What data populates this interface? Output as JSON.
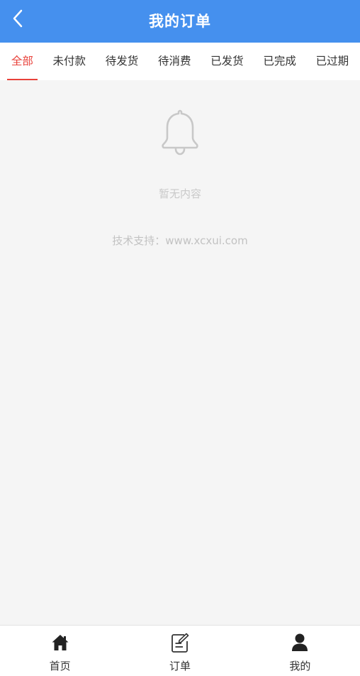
{
  "header": {
    "title": "我的订单",
    "back_icon": "chevron-left-icon",
    "bg_color": "#4590ee"
  },
  "tabs": [
    {
      "label": "全部",
      "active": true
    },
    {
      "label": "未付款",
      "active": false
    },
    {
      "label": "待发货",
      "active": false
    },
    {
      "label": "待消费",
      "active": false
    },
    {
      "label": "已发货",
      "active": false
    },
    {
      "label": "已完成",
      "active": false
    },
    {
      "label": "已过期",
      "active": false
    }
  ],
  "empty_state": {
    "icon": "bell-icon",
    "text": "暂无内容"
  },
  "support_text": "技术支持：www.xcxui.com",
  "bottom_nav": [
    {
      "label": "首页",
      "icon": "home-icon"
    },
    {
      "label": "订单",
      "icon": "order-icon"
    },
    {
      "label": "我的",
      "icon": "user-icon"
    }
  ],
  "colors": {
    "accent": "#e8413a",
    "header": "#4590ee"
  }
}
